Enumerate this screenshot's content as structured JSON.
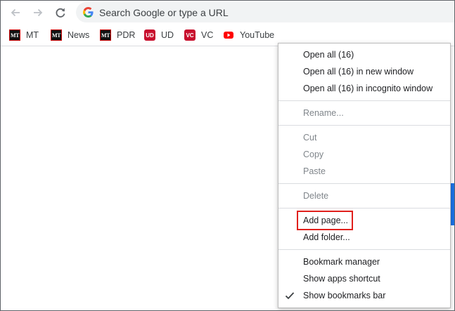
{
  "toolbar": {
    "back_icon": "arrow-left-icon",
    "forward_icon": "arrow-right-icon",
    "reload_icon": "reload-icon",
    "omnibox_placeholder": "Search Google or type a URL"
  },
  "bookmarks": [
    {
      "label": "MT",
      "icon": "mt-favicon"
    },
    {
      "label": "News",
      "icon": "mt-favicon"
    },
    {
      "label": "PDR",
      "icon": "mt-favicon"
    },
    {
      "label": "UD",
      "icon": "ud-favicon"
    },
    {
      "label": "VC",
      "icon": "vc-favicon"
    },
    {
      "label": "YouTube",
      "icon": "youtube-icon"
    }
  ],
  "favicon_text": {
    "mt": "MT",
    "ud": "UD",
    "vc": "VC"
  },
  "menu": {
    "open_all": "Open all (16)",
    "open_all_new_window": "Open all (16) in new window",
    "open_all_incognito": "Open all (16) in incognito window",
    "rename": "Rename...",
    "cut": "Cut",
    "copy": "Copy",
    "paste": "Paste",
    "delete": "Delete",
    "add_page": "Add page...",
    "add_folder": "Add folder...",
    "bookmark_manager": "Bookmark manager",
    "show_apps_shortcut": "Show apps shortcut",
    "show_bookmarks_bar": "Show bookmarks bar"
  },
  "colors": {
    "highlight": "#e0201c",
    "accent_blue": "#1a73e8",
    "youtube_red": "#ff0000"
  }
}
